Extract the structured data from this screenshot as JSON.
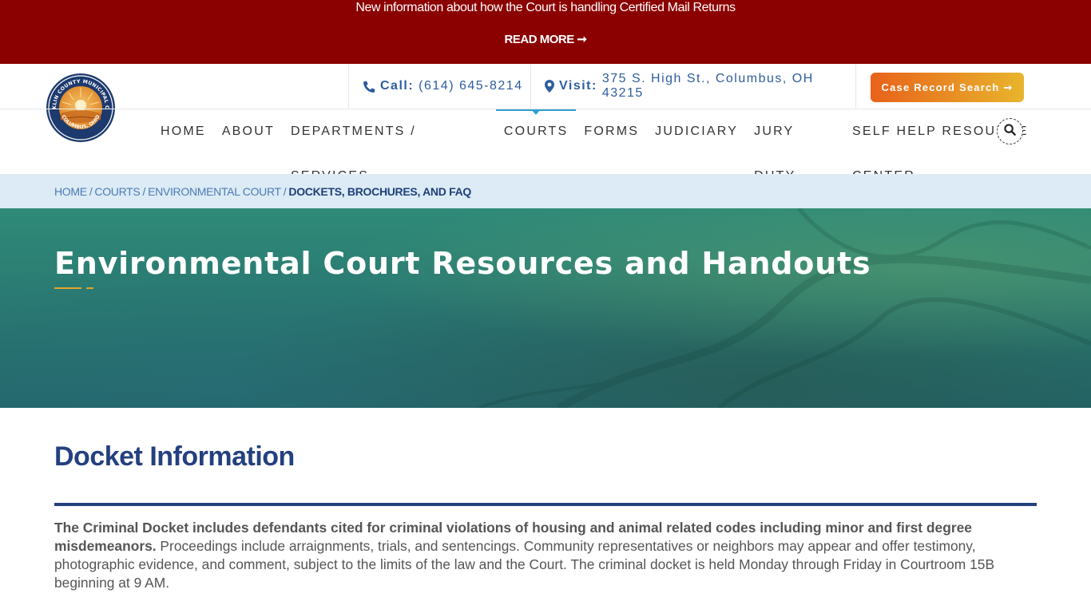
{
  "alert": {
    "text": "New information about how the Court is handling Certified Mail Returns",
    "link_label": "READ MORE ➞"
  },
  "header": {
    "logo_alt": "Franklin County Municipal Court Columbus, Ohio",
    "call_label": "Call:",
    "call_value": "(614) 645-8214",
    "visit_label": "Visit:",
    "visit_value": "375 S. High St., Columbus, OH 43215",
    "case_search_label": "Case Record Search ➞"
  },
  "nav": {
    "items": [
      {
        "label": "HOME"
      },
      {
        "label": "ABOUT"
      },
      {
        "label": "DEPARTMENTS / SERVICES"
      },
      {
        "label": "COURTS"
      },
      {
        "label": "FORMS"
      },
      {
        "label": "JUDICIARY"
      },
      {
        "label": "JURY DUTY"
      },
      {
        "label": "SELF HELP RESOURCE CENTER"
      }
    ],
    "active": "COURTS"
  },
  "breadcrumb": {
    "items": [
      "HOME",
      "COURTS",
      "ENVIRONMENTAL COURT"
    ],
    "separator": "/",
    "current": "DOCKETS, BROCHURES, AND FAQ"
  },
  "hero": {
    "title": "Environmental Court Resources and Handouts"
  },
  "content": {
    "section_title": "Docket Information",
    "para_bold": "The Criminal Docket includes defendants cited for criminal violations of housing and animal related codes including minor and first degree misdemeanors.",
    "para_rest": " Proceedings include arraignments, trials, and sentencings. Community representatives or neighbors may appear and offer testimony, photographic evidence, and comment, subject to the limits of the law and the Court. The criminal docket is held Monday through Friday in Courtroom 15B beginning at 9 AM."
  },
  "colors": {
    "alert_bg": "#8b0000",
    "brand_blue": "#24407f",
    "accent_orange": "#e8621a",
    "accent_gold": "#e3a32a",
    "breadcrumb_bg": "#dcebf5"
  }
}
